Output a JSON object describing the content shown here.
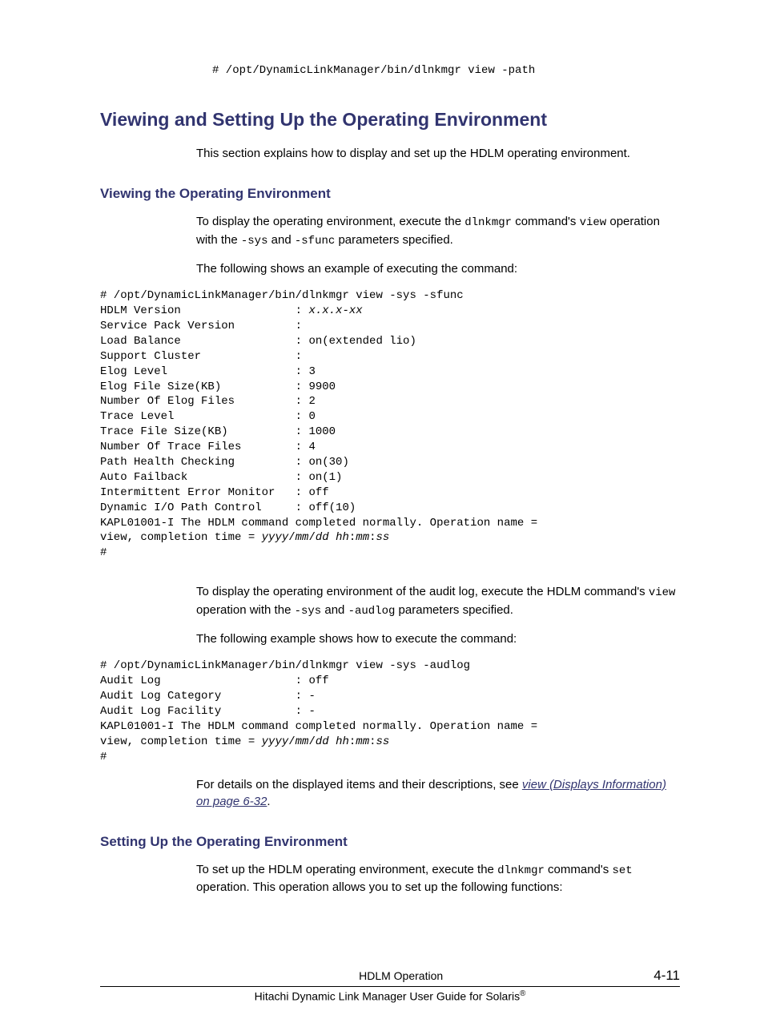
{
  "top_cmd": "# /opt/DynamicLinkManager/bin/dlnkmgr view -path",
  "h1": "Viewing and Setting Up the Operating Environment",
  "intro": "This section explains how to display and set up the HDLM operating environment.",
  "sec1": {
    "h2": "Viewing the Operating Environment",
    "p1_a": "To display the operating environment, execute the ",
    "p1_cmd": "dlnkmgr",
    "p1_b": " command's ",
    "p1_op": "view",
    "p1_c": " operation with the ",
    "p1_p1": "-sys",
    "p1_d": " and ",
    "p1_p2": "-sfunc",
    "p1_e": " parameters specified.",
    "p2": "The following shows an example of executing the command:",
    "code1_line1": "# /opt/DynamicLinkManager/bin/dlnkmgr view -sys -sfunc",
    "code1_line2a": "HDLM Version                 : ",
    "code1_line2b": "x.x.x-xx",
    "code1_line3": "Service Pack Version         :",
    "code1_line4": "Load Balance                 : on(extended lio)",
    "code1_line5": "Support Cluster              :",
    "code1_line6": "Elog Level                   : 3",
    "code1_line7": "Elog File Size(KB)           : 9900",
    "code1_line8": "Number Of Elog Files         : 2",
    "code1_line9": "Trace Level                  : 0",
    "code1_line10": "Trace File Size(KB)          : 1000",
    "code1_line11": "Number Of Trace Files        : 4",
    "code1_line12": "Path Health Checking         : on(30)",
    "code1_line13": "Auto Failback                : on(1)",
    "code1_line14": "Intermittent Error Monitor   : off",
    "code1_line15": "Dynamic I/O Path Control     : off(10)",
    "code1_line16": "KAPL01001-I The HDLM command completed normally. Operation name = ",
    "code1_line17a": "view, completion time = ",
    "code1_line17b": "yyyy",
    "code1_line17c": "/",
    "code1_line17d": "mm",
    "code1_line17e": "/",
    "code1_line17f": "dd hh",
    "code1_line17g": ":",
    "code1_line17h": "mm",
    "code1_line17i": ":",
    "code1_line17j": "ss",
    "code1_line18": "#",
    "p3_a": "To display the operating environment of the audit log, execute the HDLM command's ",
    "p3_op": "view",
    "p3_b": " operation with the ",
    "p3_p1": "-sys",
    "p3_c": " and ",
    "p3_p2": "-audlog",
    "p3_d": " parameters specified.",
    "p4": "The following example shows how to execute the command:",
    "code2_line1": "# /opt/DynamicLinkManager/bin/dlnkmgr view -sys -audlog",
    "code2_line2": "Audit Log                    : off",
    "code2_line3": "Audit Log Category           : -",
    "code2_line4": "Audit Log Facility           : -",
    "code2_line5": "KAPL01001-I The HDLM command completed normally. Operation name = ",
    "code2_line6a": "view, completion time = ",
    "code2_line6b": "yyyy",
    "code2_line6c": "/",
    "code2_line6d": "mm",
    "code2_line6e": "/",
    "code2_line6f": "dd hh",
    "code2_line6g": ":",
    "code2_line6h": "mm",
    "code2_line6i": ":",
    "code2_line6j": "ss",
    "code2_line7": "#",
    "p5_a": "For details on the displayed items and their descriptions, see ",
    "p5_link": "view (Displays Information) on page 6-32",
    "p5_b": "."
  },
  "sec2": {
    "h2": "Setting Up the Operating Environment",
    "p1_a": "To set up the HDLM operating environment, execute the ",
    "p1_cmd": "dlnkmgr",
    "p1_b": " command's ",
    "p1_op": "set",
    "p1_c": " operation. This operation allows you to set up the following functions:"
  },
  "footer": {
    "center": "HDLM Operation",
    "page": "4-11",
    "bottom_a": "Hitachi Dynamic Link Manager User Guide for Solaris",
    "bottom_reg": "®"
  }
}
